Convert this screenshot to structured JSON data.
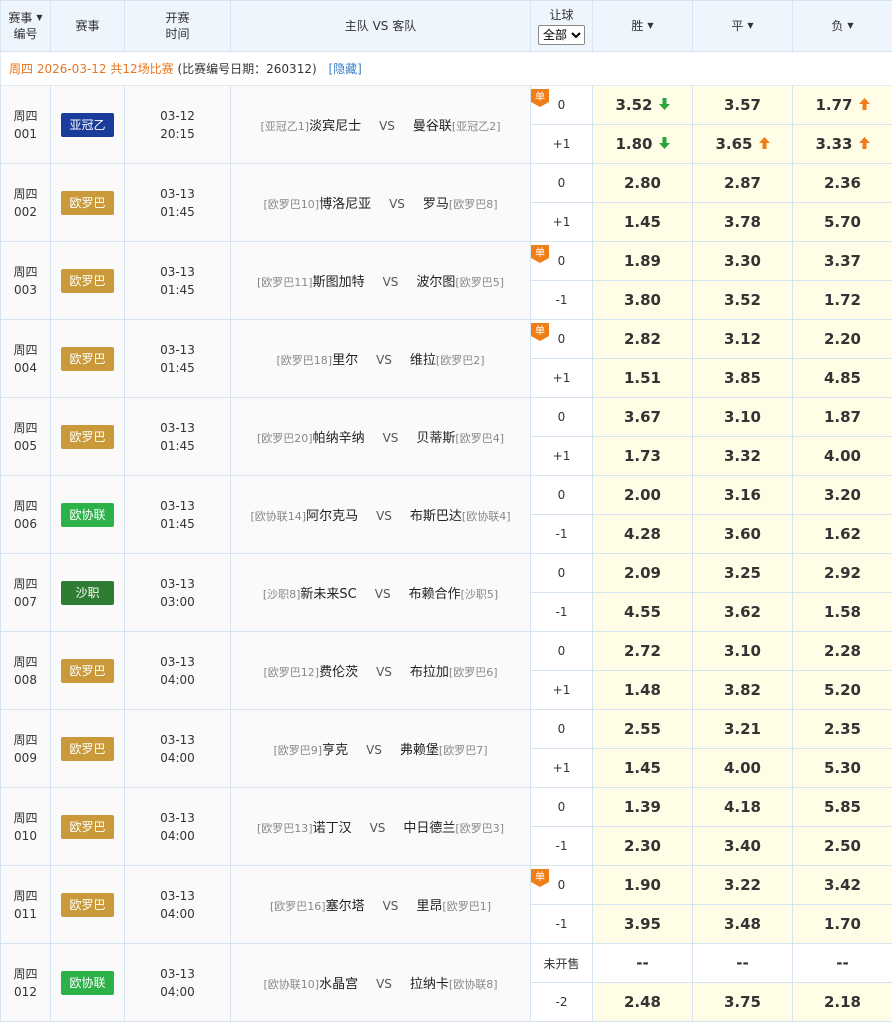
{
  "header": {
    "col_code_line1": "赛事",
    "col_code_line2": "编号",
    "col_league": "赛事",
    "col_time_line1": "开赛",
    "col_time_line2": "时间",
    "col_teams": "主队 VS 客队",
    "col_handicap": "让球",
    "handicap_select": "全部",
    "col_win": "胜",
    "col_draw": "平",
    "col_lose": "负"
  },
  "info": {
    "date_text": "周四 2026-03-12 共12场比赛",
    "code_date_text": "(比赛编号日期：260312)",
    "hide_link": "[隐藏]"
  },
  "colors": {
    "afc2": "#1a3d9c",
    "uel": "#c9993a",
    "uecl": "#2db24a",
    "saudi": "#2e7d32",
    "up": "#ef7d18",
    "down": "#2aa53c",
    "single": "#ef7d18"
  },
  "vs_text": "VS",
  "single_text": "单",
  "matches": [
    {
      "day": "周四",
      "num": "001",
      "league": "亚冠乙",
      "league_color": "afc2",
      "date": "03-12",
      "time": "20:15",
      "home_rank": "[亚冠乙1]",
      "home": "淡宾尼士",
      "away": "曼谷联",
      "away_rank": "[亚冠乙2]",
      "single": true,
      "hc0": "0",
      "hc1": "+1",
      "odds0": [
        "3.52",
        "3.57",
        "1.77"
      ],
      "arrows0": [
        "down",
        "",
        "up"
      ],
      "odds1": [
        "1.80",
        "3.65",
        "3.33"
      ],
      "arrows1": [
        "down",
        "up",
        "up"
      ]
    },
    {
      "day": "周四",
      "num": "002",
      "league": "欧罗巴",
      "league_color": "uel",
      "date": "03-13",
      "time": "01:45",
      "home_rank": "[欧罗巴10]",
      "home": "博洛尼亚",
      "away": "罗马",
      "away_rank": "[欧罗巴8]",
      "single": false,
      "hc0": "0",
      "hc1": "+1",
      "odds0": [
        "2.80",
        "2.87",
        "2.36"
      ],
      "arrows0": [
        "",
        "",
        ""
      ],
      "odds1": [
        "1.45",
        "3.78",
        "5.70"
      ],
      "arrows1": [
        "",
        "",
        ""
      ]
    },
    {
      "day": "周四",
      "num": "003",
      "league": "欧罗巴",
      "league_color": "uel",
      "date": "03-13",
      "time": "01:45",
      "home_rank": "[欧罗巴11]",
      "home": "斯图加特",
      "away": "波尔图",
      "away_rank": "[欧罗巴5]",
      "single": true,
      "hc0": "0",
      "hc1": "-1",
      "odds0": [
        "1.89",
        "3.30",
        "3.37"
      ],
      "arrows0": [
        "",
        "",
        ""
      ],
      "odds1": [
        "3.80",
        "3.52",
        "1.72"
      ],
      "arrows1": [
        "",
        "",
        ""
      ]
    },
    {
      "day": "周四",
      "num": "004",
      "league": "欧罗巴",
      "league_color": "uel",
      "date": "03-13",
      "time": "01:45",
      "home_rank": "[欧罗巴18]",
      "home": "里尔",
      "away": "维拉",
      "away_rank": "[欧罗巴2]",
      "single": true,
      "hc0": "0",
      "hc1": "+1",
      "odds0": [
        "2.82",
        "3.12",
        "2.20"
      ],
      "arrows0": [
        "",
        "",
        ""
      ],
      "odds1": [
        "1.51",
        "3.85",
        "4.85"
      ],
      "arrows1": [
        "",
        "",
        ""
      ]
    },
    {
      "day": "周四",
      "num": "005",
      "league": "欧罗巴",
      "league_color": "uel",
      "date": "03-13",
      "time": "01:45",
      "home_rank": "[欧罗巴20]",
      "home": "帕纳辛纳",
      "away": "贝蒂斯",
      "away_rank": "[欧罗巴4]",
      "single": false,
      "hc0": "0",
      "hc1": "+1",
      "odds0": [
        "3.67",
        "3.10",
        "1.87"
      ],
      "arrows0": [
        "",
        "",
        ""
      ],
      "odds1": [
        "1.73",
        "3.32",
        "4.00"
      ],
      "arrows1": [
        "",
        "",
        ""
      ]
    },
    {
      "day": "周四",
      "num": "006",
      "league": "欧协联",
      "league_color": "uecl",
      "date": "03-13",
      "time": "01:45",
      "home_rank": "[欧协联14]",
      "home": "阿尔克马",
      "away": "布斯巴达",
      "away_rank": "[欧协联4]",
      "single": false,
      "hc0": "0",
      "hc1": "-1",
      "odds0": [
        "2.00",
        "3.16",
        "3.20"
      ],
      "arrows0": [
        "",
        "",
        ""
      ],
      "odds1": [
        "4.28",
        "3.60",
        "1.62"
      ],
      "arrows1": [
        "",
        "",
        ""
      ]
    },
    {
      "day": "周四",
      "num": "007",
      "league": "沙职",
      "league_color": "saudi",
      "date": "03-13",
      "time": "03:00",
      "home_rank": "[沙职8]",
      "home": "新未来SC",
      "away": "布赖合作",
      "away_rank": "[沙职5]",
      "single": false,
      "hc0": "0",
      "hc1": "-1",
      "odds0": [
        "2.09",
        "3.25",
        "2.92"
      ],
      "arrows0": [
        "",
        "",
        ""
      ],
      "odds1": [
        "4.55",
        "3.62",
        "1.58"
      ],
      "arrows1": [
        "",
        "",
        ""
      ]
    },
    {
      "day": "周四",
      "num": "008",
      "league": "欧罗巴",
      "league_color": "uel",
      "date": "03-13",
      "time": "04:00",
      "home_rank": "[欧罗巴12]",
      "home": "费伦茨",
      "away": "布拉加",
      "away_rank": "[欧罗巴6]",
      "single": false,
      "hc0": "0",
      "hc1": "+1",
      "odds0": [
        "2.72",
        "3.10",
        "2.28"
      ],
      "arrows0": [
        "",
        "",
        ""
      ],
      "odds1": [
        "1.48",
        "3.82",
        "5.20"
      ],
      "arrows1": [
        "",
        "",
        ""
      ]
    },
    {
      "day": "周四",
      "num": "009",
      "league": "欧罗巴",
      "league_color": "uel",
      "date": "03-13",
      "time": "04:00",
      "home_rank": "[欧罗巴9]",
      "home": "亨克",
      "away": "弗赖堡",
      "away_rank": "[欧罗巴7]",
      "single": false,
      "hc0": "0",
      "hc1": "+1",
      "odds0": [
        "2.55",
        "3.21",
        "2.35"
      ],
      "arrows0": [
        "",
        "",
        ""
      ],
      "odds1": [
        "1.45",
        "4.00",
        "5.30"
      ],
      "arrows1": [
        "",
        "",
        ""
      ]
    },
    {
      "day": "周四",
      "num": "010",
      "league": "欧罗巴",
      "league_color": "uel",
      "date": "03-13",
      "time": "04:00",
      "home_rank": "[欧罗巴13]",
      "home": "诺丁汉",
      "away": "中日德兰",
      "away_rank": "[欧罗巴3]",
      "single": false,
      "hc0": "0",
      "hc1": "-1",
      "odds0": [
        "1.39",
        "4.18",
        "5.85"
      ],
      "arrows0": [
        "",
        "",
        ""
      ],
      "odds1": [
        "2.30",
        "3.40",
        "2.50"
      ],
      "arrows1": [
        "",
        "",
        ""
      ]
    },
    {
      "day": "周四",
      "num": "011",
      "league": "欧罗巴",
      "league_color": "uel",
      "date": "03-13",
      "time": "04:00",
      "home_rank": "[欧罗巴16]",
      "home": "塞尔塔",
      "away": "里昂",
      "away_rank": "[欧罗巴1]",
      "single": true,
      "hc0": "0",
      "hc1": "-1",
      "odds0": [
        "1.90",
        "3.22",
        "3.42"
      ],
      "arrows0": [
        "",
        "",
        ""
      ],
      "odds1": [
        "3.95",
        "3.48",
        "1.70"
      ],
      "arrows1": [
        "",
        "",
        ""
      ]
    },
    {
      "day": "周四",
      "num": "012",
      "league": "欧协联",
      "league_color": "uecl",
      "date": "03-13",
      "time": "04:00",
      "home_rank": "[欧协联10]",
      "home": "水晶宫",
      "away": "拉纳卡",
      "away_rank": "[欧协联8]",
      "single": false,
      "hc0": "未开售",
      "hc1": "-2",
      "odds0": [
        "--",
        "--",
        "--"
      ],
      "arrows0": [
        "",
        "",
        ""
      ],
      "odds1": [
        "2.48",
        "3.75",
        "2.18"
      ],
      "arrows1": [
        "",
        "",
        ""
      ],
      "closed0": true
    }
  ]
}
